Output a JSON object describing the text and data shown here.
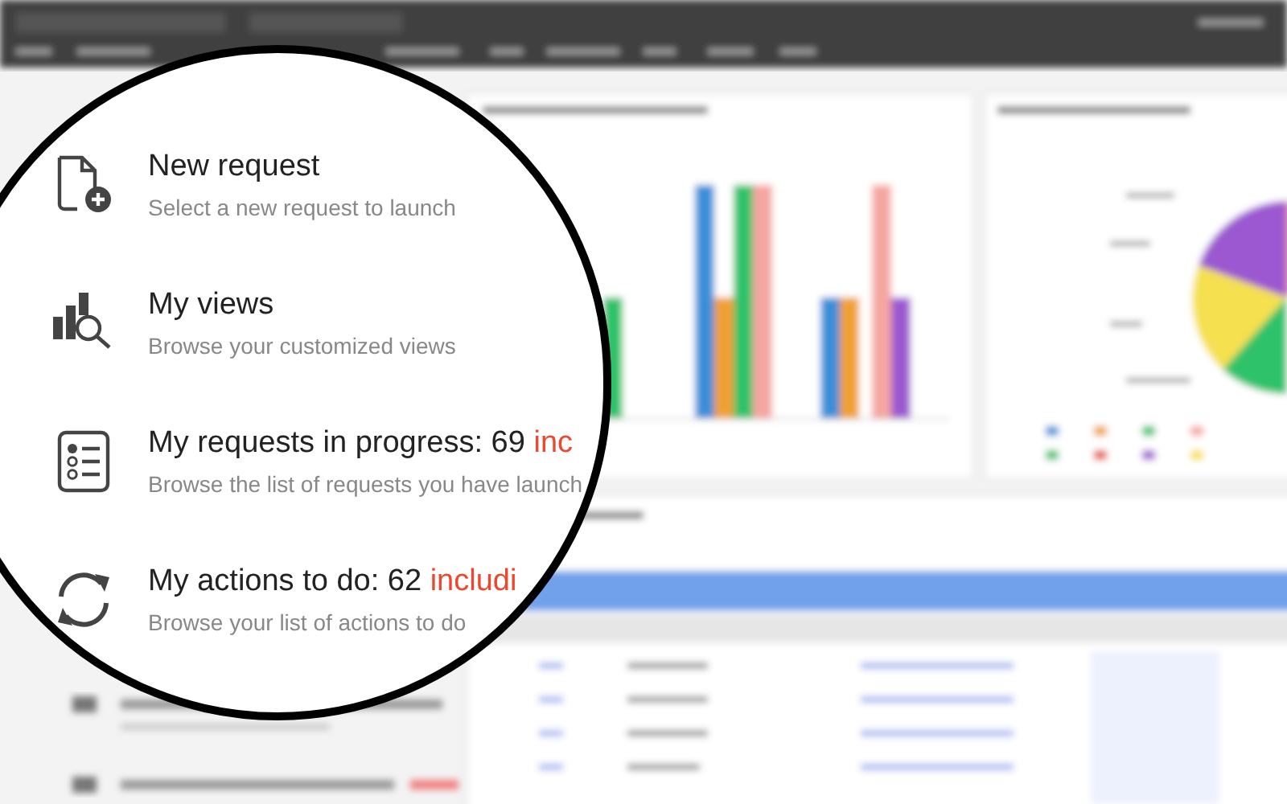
{
  "magnifier": {
    "items": [
      {
        "title": "New request",
        "subtitle": "Select a new request to launch"
      },
      {
        "title": "My views",
        "subtitle": "Browse your customized views"
      },
      {
        "title": "My requests in progress: 69",
        "highlight": "inc",
        "subtitle": "Browse the list of requests you have launch"
      },
      {
        "title": "My actions to do: 62",
        "highlight": "includi",
        "subtitle": "Browse your list of actions to do"
      }
    ]
  }
}
